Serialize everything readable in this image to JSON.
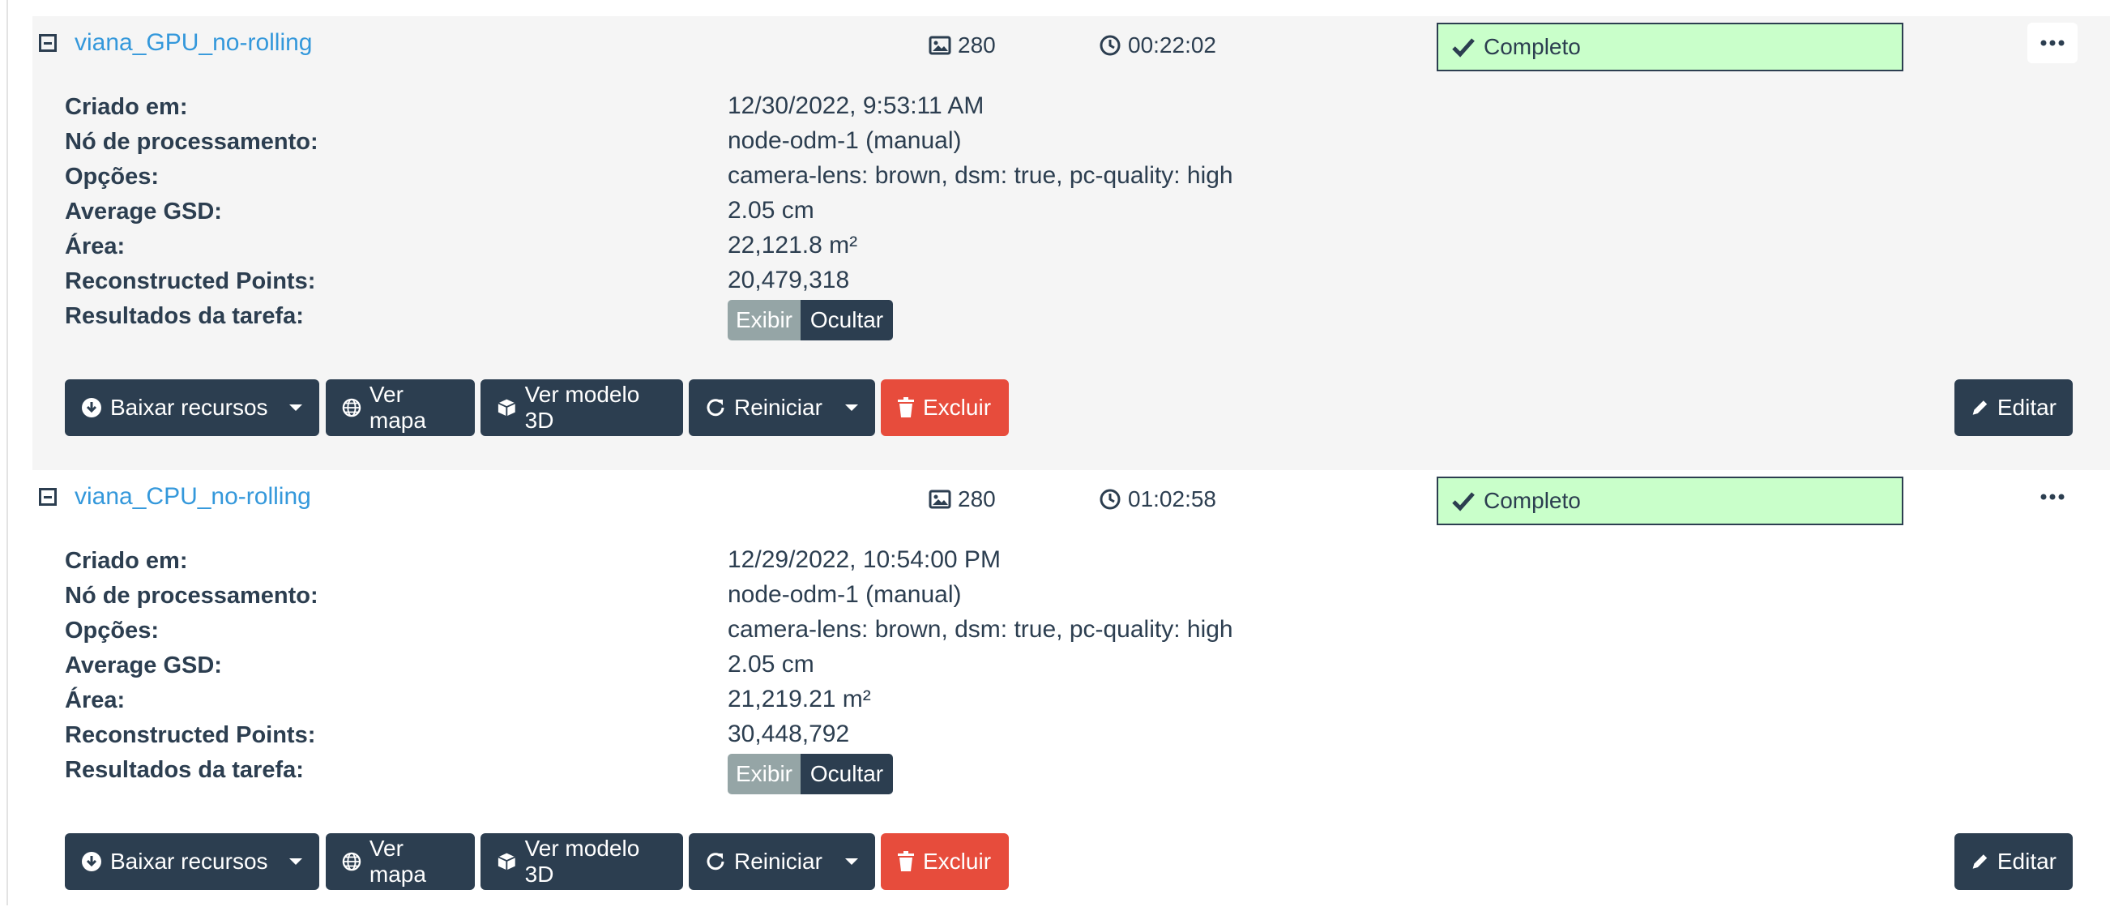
{
  "labels": {
    "created": "Criado em:",
    "node": "Nó de processamento:",
    "options": "Opções:",
    "gsd": "Average GSD:",
    "area": "Área:",
    "points": "Reconstructed Points:",
    "results": "Resultados da tarefa:"
  },
  "buttons": {
    "download": "Baixar recursos",
    "map": "Ver mapa",
    "model": "Ver modelo 3D",
    "restart": "Reiniciar",
    "delete": "Excluir",
    "edit": "Editar",
    "show": "Exibir",
    "hide": "Ocultar"
  },
  "colors": {
    "accent": "#3498db",
    "dark": "#2c3e50",
    "danger": "#e74c3c",
    "success_bg": "#c9ffca",
    "muted": "#95a5a6"
  },
  "icons": [
    "collapse-icon",
    "image-icon",
    "clock-icon",
    "check-icon",
    "ellipsis-icon",
    "download-icon",
    "globe-icon",
    "cube-icon",
    "refresh-icon",
    "trash-icon",
    "pencil-icon",
    "caret-down-icon"
  ],
  "tasks": [
    {
      "name": "viana_GPU_no-rolling",
      "images": "280",
      "duration": "00:22:02",
      "status": "Completo",
      "created": "12/30/2022, 9:53:11 AM",
      "node": "node-odm-1 (manual)",
      "options": "camera-lens: brown, dsm: true, pc-quality: high",
      "gsd": "2.05 cm",
      "area": "22,121.8 m²",
      "points": "20,479,318"
    },
    {
      "name": "viana_CPU_no-rolling",
      "images": "280",
      "duration": "01:02:58",
      "status": "Completo",
      "created": "12/29/2022, 10:54:00 PM",
      "node": "node-odm-1 (manual)",
      "options": "camera-lens: brown, dsm: true, pc-quality: high",
      "gsd": "2.05 cm",
      "area": "21,219.21 m²",
      "points": "30,448,792"
    }
  ]
}
